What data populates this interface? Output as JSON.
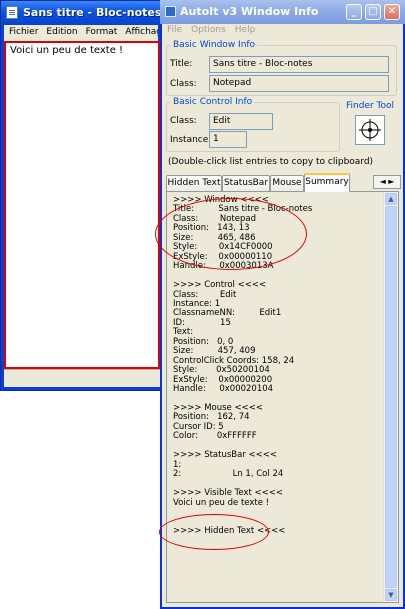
{
  "notepad": {
    "title": "Sans titre - Bloc-notes",
    "menu": [
      "Fichier",
      "Edition",
      "Format",
      "Affichage"
    ],
    "text": "Voici un peu de texte !"
  },
  "autoit": {
    "title": "AutoIt v3 Window Info",
    "menu": [
      "File",
      "Options",
      "Help"
    ],
    "buttons": {
      "minimize": "_",
      "maximize": "□",
      "close": "✕"
    },
    "basic_window": {
      "legend": "Basic Window Info",
      "title_label": "Title:",
      "title_value": "Sans titre - Bloc-notes",
      "class_label": "Class:",
      "class_value": "Notepad"
    },
    "basic_control": {
      "legend": "Basic Control Info",
      "class_label": "Class:",
      "class_value": "Edit",
      "instance_label": "Instance:",
      "instance_value": "1"
    },
    "finder_tool": "Finder Tool",
    "hint": "(Double-click list entries to copy to clipboard)",
    "tabs": [
      "Hidden Text",
      "StatusBar",
      "Mouse",
      "Summary"
    ],
    "active_tab": "Summary",
    "tab_arrows": "◄ ►",
    "summary_lines": [
      ">>>> Window <<<<",
      "Title:         Sans titre - Bloc-notes",
      "Class:        Notepad",
      "Position:   143, 13",
      "Size:         465, 486",
      "Style:        0x14CF0000",
      "ExStyle:    0x00000110",
      "Handle:     0x0003013A",
      "",
      ">>>> Control <<<<",
      "Class:        Edit",
      "Instance: 1",
      "ClassnameNN:         Edit1",
      "ID:             15",
      "Text:",
      "Position:   0, 0",
      "Size:         457, 409",
      "ControlClick Coords: 158, 24",
      "Style:       0x50200104",
      "ExStyle:    0x00000200",
      "Handle:     0x00020104",
      "",
      ">>>> Mouse <<<<",
      "Position:   162, 74",
      "Cursor ID: 5",
      "Color:       0xFFFFFF",
      "",
      ">>>> StatusBar <<<<",
      "1:",
      "2:                   Ln 1, Col 24",
      "",
      ">>>> Visible Text <<<<",
      "Voici un peu de texte !",
      "",
      "",
      ">>>> Hidden Text <<<<"
    ]
  },
  "colors": {
    "accent": "#0046d5",
    "highlight": "#e10000"
  }
}
